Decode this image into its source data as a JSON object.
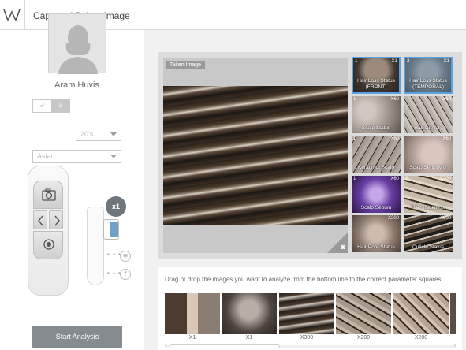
{
  "app": {
    "title": "Capture / Select Image"
  },
  "profile": {
    "name": "Aram Huvis",
    "gender_options": [
      "♂",
      "♀"
    ],
    "age_value": "20's",
    "ethnicity_value": "Asian"
  },
  "device": {
    "zoom_label": "x1"
  },
  "actions": {
    "start_analysis": "Start Analysis"
  },
  "viewer": {
    "taken_label": "Taken Image"
  },
  "thumbnails": [
    {
      "num": "1",
      "zoom": "X1",
      "label": "Hair Loss Status\n(FRONT)",
      "selected": true
    },
    {
      "num": "2",
      "zoom": "X1",
      "label": "Hair Loss Status\n(TEMPORAL)",
      "selected": true
    },
    {
      "num": "1",
      "zoom": "X60",
      "label": "Scalp Status",
      "selected": false
    },
    {
      "num": "",
      "zoom": "X60",
      "label": "Hair Density",
      "selected": false
    },
    {
      "num": "1",
      "zoom": "X60",
      "label": "Keratin of Scalp",
      "selected": false
    },
    {
      "num": "",
      "zoom": "X60",
      "label": "Scalp Sensitivity",
      "selected": false
    },
    {
      "num": "1",
      "zoom": "X60",
      "label": "Scalp Sebum",
      "selected": false
    },
    {
      "num": "2",
      "zoom": "X200",
      "label": "Hair Thickness",
      "selected": false
    },
    {
      "num": "",
      "zoom": "X200",
      "label": "Hair Pore Status",
      "selected": false
    },
    {
      "num": "",
      "zoom": "X500",
      "label": "Cuticle Status",
      "selected": false
    }
  ],
  "drop_zone": {
    "hint": "Drag or drop the images you want to analyze from the bottom line to the correct parameter squares."
  },
  "strip_images": [
    {
      "label": "X1"
    },
    {
      "label": "X1"
    },
    {
      "label": "X300"
    },
    {
      "label": "X200"
    },
    {
      "label": "X200"
    }
  ]
}
